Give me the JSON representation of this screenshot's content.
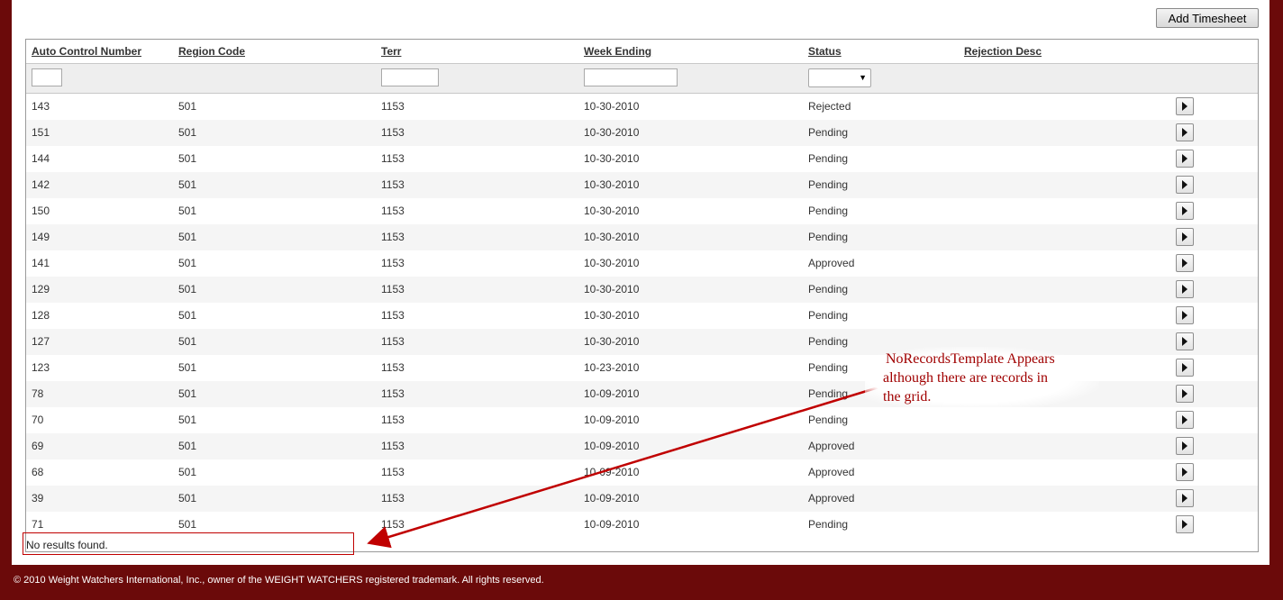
{
  "toolbar": {
    "add_label": "Add Timesheet"
  },
  "grid": {
    "columns": [
      "Auto Control Number",
      "Region Code",
      "Terr",
      "Week Ending",
      "Status",
      "Rejection Desc"
    ],
    "rows": [
      {
        "acn": "143",
        "region": "501",
        "terr": "1153",
        "week": "10-30-2010",
        "status": "Rejected"
      },
      {
        "acn": "151",
        "region": "501",
        "terr": "1153",
        "week": "10-30-2010",
        "status": "Pending"
      },
      {
        "acn": "144",
        "region": "501",
        "terr": "1153",
        "week": "10-30-2010",
        "status": "Pending"
      },
      {
        "acn": "142",
        "region": "501",
        "terr": "1153",
        "week": "10-30-2010",
        "status": "Pending"
      },
      {
        "acn": "150",
        "region": "501",
        "terr": "1153",
        "week": "10-30-2010",
        "status": "Pending"
      },
      {
        "acn": "149",
        "region": "501",
        "terr": "1153",
        "week": "10-30-2010",
        "status": "Pending"
      },
      {
        "acn": "141",
        "region": "501",
        "terr": "1153",
        "week": "10-30-2010",
        "status": "Approved"
      },
      {
        "acn": "129",
        "region": "501",
        "terr": "1153",
        "week": "10-30-2010",
        "status": "Pending"
      },
      {
        "acn": "128",
        "region": "501",
        "terr": "1153",
        "week": "10-30-2010",
        "status": "Pending"
      },
      {
        "acn": "127",
        "region": "501",
        "terr": "1153",
        "week": "10-30-2010",
        "status": "Pending"
      },
      {
        "acn": "123",
        "region": "501",
        "terr": "1153",
        "week": "10-23-2010",
        "status": "Pending"
      },
      {
        "acn": "78",
        "region": "501",
        "terr": "1153",
        "week": "10-09-2010",
        "status": "Pending"
      },
      {
        "acn": "70",
        "region": "501",
        "terr": "1153",
        "week": "10-09-2010",
        "status": "Pending"
      },
      {
        "acn": "69",
        "region": "501",
        "terr": "1153",
        "week": "10-09-2010",
        "status": "Approved"
      },
      {
        "acn": "68",
        "region": "501",
        "terr": "1153",
        "week": "10-09-2010",
        "status": "Approved"
      },
      {
        "acn": "39",
        "region": "501",
        "terr": "1153",
        "week": "10-09-2010",
        "status": "Approved"
      },
      {
        "acn": "71",
        "region": "501",
        "terr": "1153",
        "week": "10-09-2010",
        "status": "Pending"
      }
    ],
    "no_records": "No results found."
  },
  "annotation": {
    "line1": "NoRecordsTemplate Appears",
    "line2": "although there are records in",
    "line3": "the grid.",
    "color": "#a00000"
  },
  "icons": {
    "row_action": "play-triangle-icon",
    "select_arrow": "dropdown-arrow-icon"
  },
  "footer": {
    "text": "© 2010 Weight Watchers International, Inc., owner of the WEIGHT WATCHERS registered trademark. All rights reserved."
  },
  "colors": {
    "frame": "#6b0a0a",
    "highlight": "#c00000"
  }
}
